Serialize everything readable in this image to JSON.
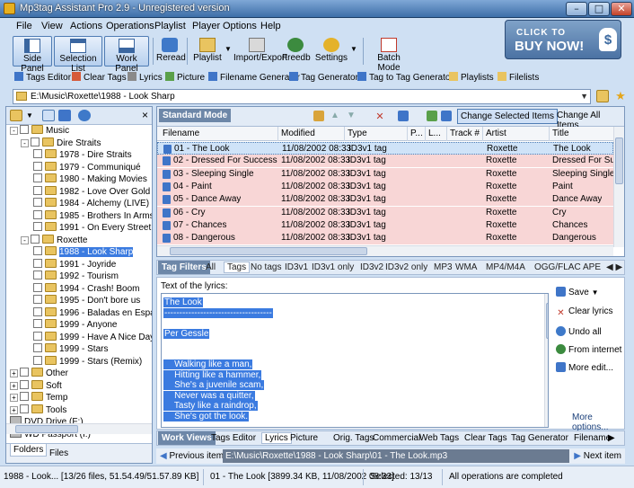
{
  "window": {
    "title": "Mp3tag Assistant Pro 2.9 - Unregistered version"
  },
  "menu": [
    "File",
    "View",
    "Actions",
    "Operations",
    "Playlist",
    "Player",
    "Options",
    "Help"
  ],
  "buy": {
    "line1": "CLICK TO",
    "line2": "BUY NOW!",
    "bag": "$"
  },
  "toolbar": {
    "side_panel": "Side Panel",
    "selection_list": "Selection List",
    "work_panel": "Work Panel",
    "reread": "Reread",
    "playlist": "Playlist",
    "import_export": "Import/Export",
    "freedb": "Freedb",
    "settings": "Settings",
    "batch_mode": "Batch Mode"
  },
  "toolbar2": [
    "Tags Editor",
    "Clear Tags",
    "Lyrics",
    "Picture",
    "Filename Generator",
    "Tag Generator",
    "Tag to Tag Generator",
    "Playlists",
    "Filelists"
  ],
  "path": "E:\\Music\\Roxette\\1988 - Look Sharp",
  "tree": [
    {
      "label": "Music",
      "level": 0,
      "exp": "-"
    },
    {
      "label": "Dire Straits",
      "level": 1,
      "exp": "-"
    },
    {
      "label": "1978 - Dire Straits",
      "level": 2
    },
    {
      "label": "1979 - Communiqué",
      "level": 2
    },
    {
      "label": "1980 - Making Movies",
      "level": 2
    },
    {
      "label": "1982 - Love Over Gold",
      "level": 2
    },
    {
      "label": "1984 - Alchemy (LIVE)",
      "level": 2
    },
    {
      "label": "1985 - Brothers In Arms",
      "level": 2
    },
    {
      "label": "1991 - On Every Street",
      "level": 2
    },
    {
      "label": "Roxette",
      "level": 1,
      "exp": "-"
    },
    {
      "label": "1988 - Look Sharp",
      "level": 2,
      "sel": true
    },
    {
      "label": "1991 - Joyride",
      "level": 2
    },
    {
      "label": "1992 - Tourism",
      "level": 2
    },
    {
      "label": "1994 - Crash! Boom",
      "level": 2
    },
    {
      "label": "1995 - Don't bore us",
      "level": 2
    },
    {
      "label": "1996 - Baladas en Español",
      "level": 2
    },
    {
      "label": "1999 - Anyone",
      "level": 2
    },
    {
      "label": "1999 - Have A Nice Day",
      "level": 2
    },
    {
      "label": "1999 - Stars",
      "level": 2
    },
    {
      "label": "1999 - Stars (Remix)",
      "level": 2
    },
    {
      "label": "Other",
      "level": 0,
      "exp": "+"
    },
    {
      "label": "Soft",
      "level": 0,
      "exp": "+"
    },
    {
      "label": "Temp",
      "level": 0,
      "exp": "+"
    },
    {
      "label": "Tools",
      "level": 0,
      "exp": "+"
    },
    {
      "label": "DVD Drive (F:)",
      "level": -1,
      "drive": true
    },
    {
      "label": "WD Passport (I:)",
      "level": -1,
      "drive": true
    }
  ],
  "left_tabs": {
    "folders": "Folders",
    "files": "Files"
  },
  "standard": {
    "title": "Standard Mode",
    "change_selected": "Change Selected Items",
    "change_all": "Change All Items",
    "columns": [
      "Filename",
      "Modified",
      "Type",
      "P...",
      "L...",
      "Track #",
      "Artist",
      "Title"
    ],
    "rows": [
      {
        "filename": "01 - The Look",
        "modified": "11/08/2002 08:33",
        "type": "ID3v1 tag",
        "artist": "Roxette",
        "title": "The Look",
        "style": "sel"
      },
      {
        "filename": "02 - Dressed For Success",
        "modified": "11/08/2002 08:33",
        "type": "ID3v1 tag",
        "artist": "Roxette",
        "title": "Dressed For Su...",
        "style": "pink"
      },
      {
        "filename": "03 - Sleeping Single",
        "modified": "11/08/2002 08:33",
        "type": "ID3v1 tag",
        "artist": "Roxette",
        "title": "Sleeping Single",
        "style": "pink"
      },
      {
        "filename": "04 - Paint",
        "modified": "11/08/2002 08:33",
        "type": "ID3v1 tag",
        "artist": "Roxette",
        "title": "Paint",
        "style": "pink"
      },
      {
        "filename": "05 - Dance Away",
        "modified": "11/08/2002 08:33",
        "type": "ID3v1 tag",
        "artist": "Roxette",
        "title": "Dance Away",
        "style": "pink"
      },
      {
        "filename": "06 - Cry",
        "modified": "11/08/2002 08:33",
        "type": "ID3v1 tag",
        "artist": "Roxette",
        "title": "Cry",
        "style": "pink"
      },
      {
        "filename": "07 - Chances",
        "modified": "11/08/2002 08:33",
        "type": "ID3v1 tag",
        "artist": "Roxette",
        "title": "Chances",
        "style": "pink"
      },
      {
        "filename": "08 - Dangerous",
        "modified": "11/08/2002 08:33",
        "type": "ID3v1 tag",
        "artist": "Roxette",
        "title": "Dangerous",
        "style": "pink"
      }
    ]
  },
  "tag_filters": {
    "title": "Tag Filters",
    "tabs": [
      "All",
      "Tags",
      "No tags",
      "ID3v1",
      "ID3v1 only",
      "ID3v2",
      "ID3v2 only",
      "MP3",
      "WMA",
      "MP4/M4A",
      "OGG/FLAC",
      "APE"
    ],
    "active": 1
  },
  "lyrics": {
    "label": "Text of the lyrics:",
    "lines": [
      "The Look",
      "------------------------------------",
      "",
      "Per Gessle",
      "",
      "",
      "    Walking like a man,",
      "    Hitting like a hammer,",
      "    She's a juvenile scam,",
      "    Never was a quitter,",
      "    Tasty like a raindrop,",
      "    She's got the look."
    ],
    "save": "Save",
    "clear": "Clear lyrics",
    "undo": "Undo all",
    "from_internet": "From internet",
    "more_edit": "More edit...",
    "more_options": "More options..."
  },
  "work_views": {
    "title": "Work Views",
    "tabs": [
      "Tags Editor",
      "Lyrics",
      "Picture",
      "Orig. Tags",
      "Commercial",
      "Web Tags",
      "Clear Tags",
      "Tag Generator",
      "Filename"
    ],
    "active": 1
  },
  "nav": {
    "prev": "Previous item",
    "next": "Next item",
    "path": "E:\\Music\\Roxette\\1988 - Look Sharp\\01 - The Look.mp3"
  },
  "status": {
    "s1": "1988 - Look... [13/26 files, 51.54.49/51.57.89 KB]",
    "s2": "01 - The Look [3899.34 KB, 11/08/2002 08:33]",
    "s3": "Selected: 13/13",
    "s4": "All operations are completed"
  }
}
